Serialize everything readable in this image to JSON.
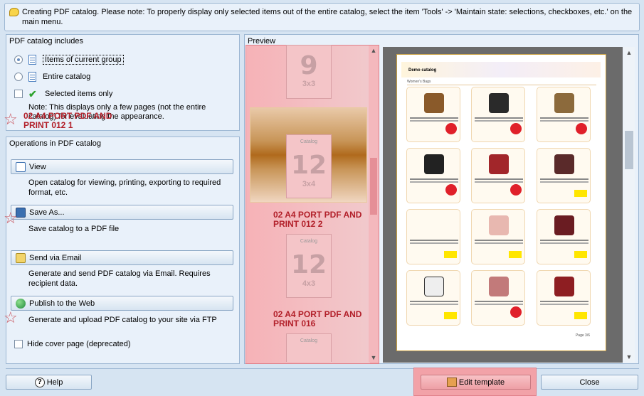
{
  "notice": {
    "text": "Creating PDF catalog. Please note: To properly display only selected items out of the entire catalog, select the item  'Tools' -> 'Maintain state: selections, checkboxes, etc.' on the main menu."
  },
  "includes": {
    "title": "PDF catalog includes",
    "options": [
      {
        "label": "Items of current group",
        "checked": true
      },
      {
        "label": "Entire catalog",
        "checked": false
      },
      {
        "label": "Selected items only",
        "checked": false
      }
    ],
    "note": "Note: This displays only a few pages (not the entire catalog) for evaluating the appearance."
  },
  "operations": {
    "title": "Operations in PDF catalog",
    "items": [
      {
        "label": "View",
        "desc": "Open catalog for viewing, printing, exporting to required format, etc."
      },
      {
        "label": "Save As...",
        "desc": "Save catalog to a PDF file"
      },
      {
        "label": "Send via Email",
        "desc": "Generate and send PDF catalog via Email. Requires recipient data."
      },
      {
        "label": "Publish to the Web",
        "desc": "Generate and upload PDF catalog to your site via FTP"
      }
    ],
    "hide_cover": "Hide cover page (deprecated)"
  },
  "preview": {
    "title": "Preview",
    "thumbs": [
      {
        "label": "",
        "catalog": "",
        "num": "9",
        "sub": "3x3"
      },
      {
        "label": "02 A4 PORT PDF AND PRINT 012 1",
        "catalog": "Catalog",
        "num": "12",
        "sub": "3x4",
        "selected": true
      },
      {
        "label": "02 A4 PORT PDF AND PRINT 012 2",
        "catalog": "Catalog",
        "num": "12",
        "sub": "4x3"
      },
      {
        "label": "02 A4 PORT PDF AND PRINT 016",
        "catalog": "Catalog",
        "num": "",
        "sub": ""
      }
    ],
    "page": {
      "heading": "Demo catalog",
      "group": "Women's Bags",
      "footer": "Page 3/6"
    }
  },
  "buttons": {
    "help": "Help",
    "edit_template": "Edit template",
    "close": "Close"
  },
  "colors": {
    "highlight": "#f2a2a8",
    "selected_band": "#b06a1c",
    "accent": "#b2202a"
  }
}
